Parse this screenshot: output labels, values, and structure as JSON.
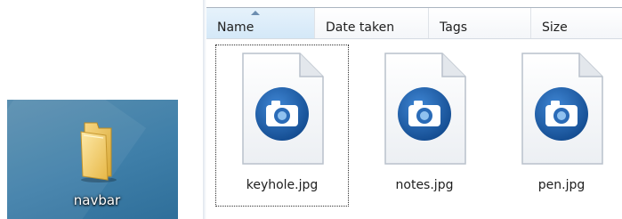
{
  "desktop": {
    "folder_label": "navbar",
    "icon": "folder-icon"
  },
  "explorer": {
    "columns": [
      {
        "label": "Name",
        "sorted": "ascending"
      },
      {
        "label": "Date taken"
      },
      {
        "label": "Tags"
      },
      {
        "label": "Size"
      }
    ],
    "files": [
      {
        "name": "keyhole.jpg",
        "icon": "camera-icon",
        "focused": true
      },
      {
        "name": "notes.jpg",
        "icon": "camera-icon"
      },
      {
        "name": "pen.jpg",
        "icon": "camera-icon"
      }
    ]
  },
  "colors": {
    "desktop_bg": "#3f7fa9",
    "sort_header_bg": "#d4e8f8",
    "camera_badge": "#1f5a9c"
  }
}
